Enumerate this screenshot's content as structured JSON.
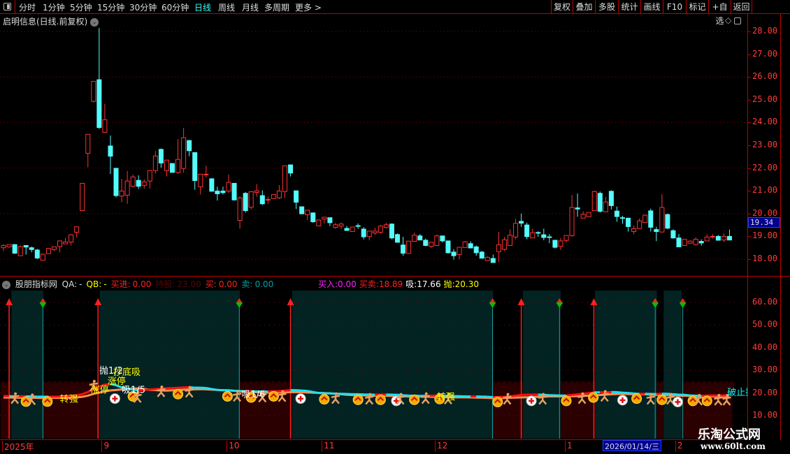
{
  "toolbar": {
    "periods": [
      "分时",
      "1分钟",
      "5分钟",
      "15分钟",
      "30分钟",
      "60分钟",
      "日线",
      "周线",
      "月线",
      "多周期",
      "更多 >"
    ],
    "active_period": "日线",
    "buttons": [
      "复权",
      "叠加",
      "多股",
      "统计",
      "画线",
      "F10",
      "标记",
      "+自选",
      "返回"
    ]
  },
  "chart": {
    "title": "启明信息(日线.前复权)",
    "price_labels": [
      "28.00",
      "27.00",
      "26.00",
      "25.00",
      "24.00",
      "23.00",
      "22.00",
      "21.00",
      "20.00",
      "19.00",
      "18.00"
    ],
    "current_price": "19.34",
    "colors": {
      "up": "#ff3232",
      "down": "#54fcfc",
      "grid": "#8b0000"
    }
  },
  "indicator": {
    "name": "股朋指标网",
    "fields": [
      {
        "label": "QA:",
        "value": "-",
        "color": "#dddddd"
      },
      {
        "label": "QB:",
        "value": "-",
        "color": "#ffff00"
      },
      {
        "label": "买进:",
        "value": "0.00",
        "color": "#ff2020"
      },
      {
        "label": "持股:",
        "value": "23.00",
        "color": "#4a0a0a"
      },
      {
        "label": "买:",
        "value": "0.00",
        "color": "#ff2020"
      },
      {
        "label": "卖:",
        "value": "0.00",
        "color": "#00a0a0"
      }
    ],
    "fields_right": [
      {
        "label": "买入:",
        "value": "0.00",
        "color": "#ff20ff"
      },
      {
        "label": "买卖:",
        "value": "18.89",
        "color": "#ff2020"
      },
      {
        "label": "吸:",
        "value": "17.66",
        "color": "#ffffff"
      },
      {
        "label": "抛:",
        "value": "20.30",
        "color": "#ffff00"
      }
    ],
    "y_labels": [
      "60.00",
      "50.00",
      "40.00",
      "30.00",
      "20.00",
      "10.00"
    ],
    "hold_zones": [
      [
        1.4,
        7.1
      ],
      [
        17.1,
        42
      ],
      [
        51.3,
        87
      ],
      [
        92.3,
        99
      ],
      [
        105.1,
        116.1
      ],
      [
        117.3,
        120.5
      ]
    ],
    "buy_arrows": [
      1,
      16.8,
      51,
      92,
      104.9
    ],
    "sell_arrows": [
      7,
      41.9,
      86.9,
      98.8,
      115.8,
      120.7
    ],
    "icons": [
      {
        "t": "man",
        "i": 2,
        "v": 17.5
      },
      {
        "t": "coin",
        "i": 4,
        "v": 16.2
      },
      {
        "t": "man",
        "i": 5,
        "v": 17
      },
      {
        "t": "coin",
        "i": 7.8,
        "v": 16.2
      },
      {
        "t": "man",
        "i": 16,
        "v": 23
      },
      {
        "t": "plus",
        "i": 19.8,
        "v": 17.5
      },
      {
        "t": "coin",
        "i": 23,
        "v": 18.5
      },
      {
        "t": "man",
        "i": 23.8,
        "v": 18
      },
      {
        "t": "man",
        "i": 28,
        "v": 20.5
      },
      {
        "t": "coin",
        "i": 31,
        "v": 19.5
      },
      {
        "t": "man",
        "i": 33,
        "v": 20.3
      },
      {
        "t": "coin",
        "i": 39.8,
        "v": 18.5
      },
      {
        "t": "man",
        "i": 41.5,
        "v": 18.5
      },
      {
        "t": "coin",
        "i": 44,
        "v": 18
      },
      {
        "t": "man",
        "i": 46,
        "v": 18.2
      },
      {
        "t": "coin",
        "i": 48,
        "v": 18.5
      },
      {
        "t": "man",
        "i": 49.5,
        "v": 18.4
      },
      {
        "t": "plus",
        "i": 52.8,
        "v": 17.5
      },
      {
        "t": "coin",
        "i": 57,
        "v": 17.2
      },
      {
        "t": "man",
        "i": 59,
        "v": 17.5
      },
      {
        "t": "coin",
        "i": 63,
        "v": 17
      },
      {
        "t": "man",
        "i": 65,
        "v": 17.2
      },
      {
        "t": "coin",
        "i": 67,
        "v": 17
      },
      {
        "t": "plus",
        "i": 69.8,
        "v": 16.5
      },
      {
        "t": "man",
        "i": 70.5,
        "v": 17.2
      },
      {
        "t": "coin",
        "i": 73,
        "v": 17
      },
      {
        "t": "man",
        "i": 75,
        "v": 17.5
      },
      {
        "t": "coin",
        "i": 77.5,
        "v": 17.3
      },
      {
        "t": "man",
        "i": 79,
        "v": 17.3
      },
      {
        "t": "coin",
        "i": 87.8,
        "v": 16
      },
      {
        "t": "man",
        "i": 89.5,
        "v": 17.2
      },
      {
        "t": "plus",
        "i": 93.8,
        "v": 16.5
      },
      {
        "t": "man",
        "i": 95.8,
        "v": 17.2
      },
      {
        "t": "coin",
        "i": 100,
        "v": 16.5
      },
      {
        "t": "man",
        "i": 102.8,
        "v": 17.5
      },
      {
        "t": "coin",
        "i": 104.8,
        "v": 18
      },
      {
        "t": "man",
        "i": 106.8,
        "v": 18.5
      },
      {
        "t": "coin",
        "i": 112.5,
        "v": 17.5
      },
      {
        "t": "man",
        "i": 115,
        "v": 17.2
      },
      {
        "t": "plus",
        "i": 110,
        "v": 16.8
      },
      {
        "t": "coin",
        "i": 117,
        "v": 17
      },
      {
        "t": "man",
        "i": 118.5,
        "v": 17.2
      },
      {
        "t": "plus",
        "i": 119.8,
        "v": 16
      },
      {
        "t": "coin",
        "i": 122.5,
        "v": 16.5
      },
      {
        "t": "man",
        "i": 123.5,
        "v": 16.8
      },
      {
        "t": "coin",
        "i": 125,
        "v": 16.5
      },
      {
        "t": "man",
        "i": 127,
        "v": 16.8
      },
      {
        "t": "man",
        "i": 128.5,
        "v": 16.8
      }
    ],
    "labels": [
      {
        "t": "抛1/2",
        "i": 17,
        "v": 30,
        "c": "#ffffff"
      },
      {
        "t": "抄底吸",
        "i": 19.5,
        "v": 29.5,
        "c": "#ffff00"
      },
      {
        "t": "涨停",
        "i": 18.5,
        "v": 25.5,
        "c": "#ffff00"
      },
      {
        "t": "涨停",
        "i": 15.5,
        "v": 21.5,
        "c": "#ffff00"
      },
      {
        "t": "转强",
        "i": 10,
        "v": 17.5,
        "c": "#ffff00"
      },
      {
        "t": "吸1/5",
        "i": 21,
        "v": 21.5,
        "c": "#ffffff"
      },
      {
        "t": "吸1/6",
        "i": 42.3,
        "v": 19.5,
        "c": "#ffffff"
      },
      {
        "t": "转强",
        "i": 77,
        "v": 18.5,
        "c": "#ffff00"
      },
      {
        "t": "破止损",
        "i": 128.6,
        "v": 20.5,
        "c": "#00ffff"
      }
    ]
  },
  "date_axis": {
    "labels": [
      {
        "t": "2025年",
        "i": 0
      },
      {
        "t": "9",
        "i": 17.7
      },
      {
        "t": "10",
        "i": 39.9
      },
      {
        "t": "11",
        "i": 56.8
      },
      {
        "t": "12",
        "i": 76.9
      },
      {
        "t": "1",
        "i": 100
      },
      {
        "t": "2",
        "i": 119.6
      }
    ],
    "cursor_date": "2026/01/14/三"
  },
  "watermark": {
    "name": "乐淘公式网",
    "url": "www.60lt.com"
  },
  "chart_data": {
    "type": "candlestick",
    "title": "启明信息(日线.前复权)",
    "ylim": [
      17.7,
      28.3
    ],
    "ohlc": [
      [
        18.5,
        18.65,
        18.35,
        18.6
      ],
      [
        18.54,
        18.64,
        18.5,
        18.64
      ],
      [
        18.64,
        18.66,
        18.23,
        18.26
      ],
      [
        18.15,
        18.6,
        18.15,
        18.55
      ],
      [
        18.6,
        18.6,
        18.2,
        18.53
      ],
      [
        18.5,
        18.55,
        18.3,
        18.42
      ],
      [
        18.4,
        18.45,
        18.0,
        18.05
      ],
      [
        17.95,
        18.22,
        17.95,
        18.22
      ],
      [
        18.24,
        18.47,
        18.24,
        18.47
      ],
      [
        18.42,
        18.55,
        18.35,
        18.54
      ],
      [
        18.55,
        18.82,
        18.3,
        18.8
      ],
      [
        18.67,
        18.93,
        18.67,
        18.75
      ],
      [
        18.75,
        19.1,
        18.6,
        19.07
      ],
      [
        19.18,
        19.43,
        18.95,
        19.42
      ],
      [
        20.13,
        21.33,
        20.13,
        21.33
      ],
      [
        22.65,
        23.48,
        22.04,
        23.48
      ],
      [
        24.93,
        25.81,
        24.88,
        25.81
      ],
      [
        25.88,
        28.15,
        23.72,
        23.78
      ],
      [
        23.57,
        24.81,
        23.57,
        24.12
      ],
      [
        22.97,
        23.43,
        21.74,
        22.52
      ],
      [
        21.99,
        21.99,
        20.72,
        20.79
      ],
      [
        20.77,
        21.53,
        20.5,
        20.99
      ],
      [
        20.81,
        21.87,
        20.43,
        21.43
      ],
      [
        21.2,
        21.71,
        21.15,
        21.61
      ],
      [
        21.46,
        21.68,
        21.08,
        21.2
      ],
      [
        21.24,
        21.5,
        21.1,
        21.39
      ],
      [
        21.43,
        21.89,
        21.1,
        21.89
      ],
      [
        21.89,
        22.75,
        21.76,
        22.53
      ],
      [
        22.82,
        22.86,
        22.02,
        22.22
      ],
      [
        21.89,
        22.35,
        21.63,
        22.35
      ],
      [
        22.2,
        22.2,
        21.81,
        21.81
      ],
      [
        21.8,
        23.27,
        21.75,
        22.38
      ],
      [
        21.98,
        23.76,
        21.81,
        23.33
      ],
      [
        23.21,
        23.21,
        22.52,
        22.76
      ],
      [
        22.68,
        22.68,
        21.05,
        21.45
      ],
      [
        21.18,
        21.73,
        20.84,
        21.73
      ],
      [
        21.7,
        22.1,
        21.58,
        21.73
      ],
      [
        21.53,
        21.53,
        20.97,
        20.98
      ],
      [
        20.99,
        21.18,
        20.57,
        20.87
      ],
      [
        20.99,
        21.18,
        20.84,
        20.92
      ],
      [
        20.99,
        21.71,
        20.9,
        21.37
      ],
      [
        21.33,
        21.33,
        20.57,
        20.6
      ],
      [
        19.7,
        20.76,
        19.34,
        20.69
      ],
      [
        20.89,
        20.94,
        20.05,
        20.13
      ],
      [
        20.28,
        20.97,
        20.18,
        20.96
      ],
      [
        20.93,
        21.3,
        20.74,
        21.0
      ],
      [
        20.79,
        21.02,
        20.38,
        20.43
      ],
      [
        20.6,
        20.74,
        20.43,
        20.62
      ],
      [
        20.66,
        20.84,
        20.66,
        20.84
      ],
      [
        20.69,
        21.25,
        20.64,
        20.99
      ],
      [
        20.97,
        22.1,
        20.69,
        22.1
      ],
      [
        22.14,
        22.14,
        21.63,
        21.78
      ],
      [
        21.0,
        21.0,
        20.2,
        20.5
      ],
      [
        20.3,
        20.3,
        19.99,
        19.99
      ],
      [
        19.95,
        20.15,
        19.72,
        20.15
      ],
      [
        20.03,
        20.05,
        19.6,
        19.64
      ],
      [
        19.46,
        19.74,
        19.46,
        19.72
      ],
      [
        19.76,
        19.85,
        19.57,
        19.84
      ],
      [
        19.82,
        19.82,
        19.45,
        19.6
      ],
      [
        19.39,
        19.59,
        19.33,
        19.51
      ],
      [
        19.45,
        19.61,
        19.33,
        19.54
      ],
      [
        19.35,
        19.45,
        19.26,
        19.26
      ],
      [
        19.21,
        19.41,
        19.21,
        19.41
      ],
      [
        19.47,
        19.57,
        19.33,
        19.45
      ],
      [
        19.32,
        19.4,
        18.87,
        18.98
      ],
      [
        18.99,
        19.23,
        18.83,
        19.23
      ],
      [
        19.15,
        19.38,
        19.06,
        19.23
      ],
      [
        19.18,
        19.5,
        19.12,
        19.45
      ],
      [
        19.39,
        19.6,
        19.34,
        19.51
      ],
      [
        19.54,
        19.57,
        18.87,
        18.93
      ],
      [
        19.08,
        19.13,
        18.72,
        18.74
      ],
      [
        18.62,
        18.98,
        18.15,
        18.26
      ],
      [
        18.25,
        18.8,
        18.25,
        18.79
      ],
      [
        18.78,
        19.16,
        18.76,
        19.05
      ],
      [
        19.02,
        19.1,
        18.84,
        18.84
      ],
      [
        18.83,
        18.9,
        18.56,
        18.6
      ],
      [
        18.56,
        18.74,
        18.49,
        18.74
      ],
      [
        18.6,
        19.08,
        18.57,
        19.02
      ],
      [
        19.02,
        19.02,
        18.73,
        18.8
      ],
      [
        18.8,
        18.8,
        18.24,
        18.28
      ],
      [
        18.31,
        18.44,
        17.98,
        18.15
      ],
      [
        18.2,
        18.52,
        18.0,
        18.52
      ],
      [
        18.51,
        18.8,
        18.49,
        18.76
      ],
      [
        18.68,
        18.79,
        18.48,
        18.49
      ],
      [
        18.54,
        18.6,
        18.15,
        18.28
      ],
      [
        18.31,
        18.36,
        18.04,
        18.04
      ],
      [
        17.94,
        18.12,
        17.94,
        18.08
      ],
      [
        18.03,
        18.2,
        17.85,
        17.85
      ],
      [
        18.33,
        19.2,
        17.86,
        18.63
      ],
      [
        18.43,
        18.98,
        18.36,
        18.85
      ],
      [
        18.6,
        19.3,
        18.6,
        19.05
      ],
      [
        18.97,
        19.77,
        18.87,
        19.57
      ],
      [
        19.66,
        20.0,
        19.42,
        19.58
      ],
      [
        19.5,
        19.6,
        18.87,
        18.99
      ],
      [
        18.93,
        19.34,
        18.93,
        19.16
      ],
      [
        19.17,
        19.22,
        18.98,
        19.14
      ],
      [
        19.07,
        19.34,
        18.83,
        18.95
      ],
      [
        18.98,
        19.1,
        18.7,
        18.97
      ],
      [
        18.83,
        18.83,
        18.47,
        18.52
      ],
      [
        18.56,
        18.93,
        18.4,
        18.8
      ],
      [
        18.82,
        19.03,
        18.73,
        19.04
      ],
      [
        19.03,
        20.82,
        18.99,
        20.27
      ],
      [
        20.25,
        20.88,
        19.86,
        20.2
      ],
      [
        19.8,
        20.1,
        19.8,
        19.97
      ],
      [
        19.86,
        20.05,
        19.86,
        20.05
      ],
      [
        20.13,
        21.01,
        20.13,
        20.97
      ],
      [
        20.89,
        20.97,
        20.04,
        20.1
      ],
      [
        20.08,
        20.74,
        20.08,
        20.51
      ],
      [
        20.98,
        21.02,
        20.18,
        20.35
      ],
      [
        20.11,
        20.31,
        19.64,
        19.87
      ],
      [
        19.82,
        19.9,
        19.55,
        19.8
      ],
      [
        19.8,
        19.8,
        19.21,
        19.43
      ],
      [
        19.21,
        19.47,
        19.09,
        19.34
      ],
      [
        19.34,
        19.78,
        19.34,
        19.68
      ],
      [
        19.61,
        19.96,
        19.61,
        19.93
      ],
      [
        20.12,
        20.22,
        19.21,
        19.4
      ],
      [
        19.3,
        19.42,
        18.79,
        19.21
      ],
      [
        19.19,
        20.85,
        19.19,
        20.27
      ],
      [
        19.96,
        20.0,
        19.31,
        19.36
      ],
      [
        19.25,
        19.31,
        18.9,
        18.93
      ],
      [
        18.93,
        19.1,
        18.54,
        18.54
      ],
      [
        18.6,
        18.87,
        18.6,
        18.87
      ],
      [
        18.7,
        18.83,
        18.67,
        18.79
      ],
      [
        18.64,
        18.95,
        18.6,
        18.87
      ],
      [
        18.78,
        18.87,
        18.59,
        18.71
      ],
      [
        18.8,
        19.1,
        18.8,
        18.97
      ],
      [
        19.0,
        19.1,
        18.9,
        19.0
      ],
      [
        19.0,
        19.06,
        18.84,
        18.83
      ],
      [
        18.84,
        19.14,
        18.75,
        19.0
      ],
      [
        19.0,
        19.3,
        18.84,
        18.84
      ]
    ]
  }
}
